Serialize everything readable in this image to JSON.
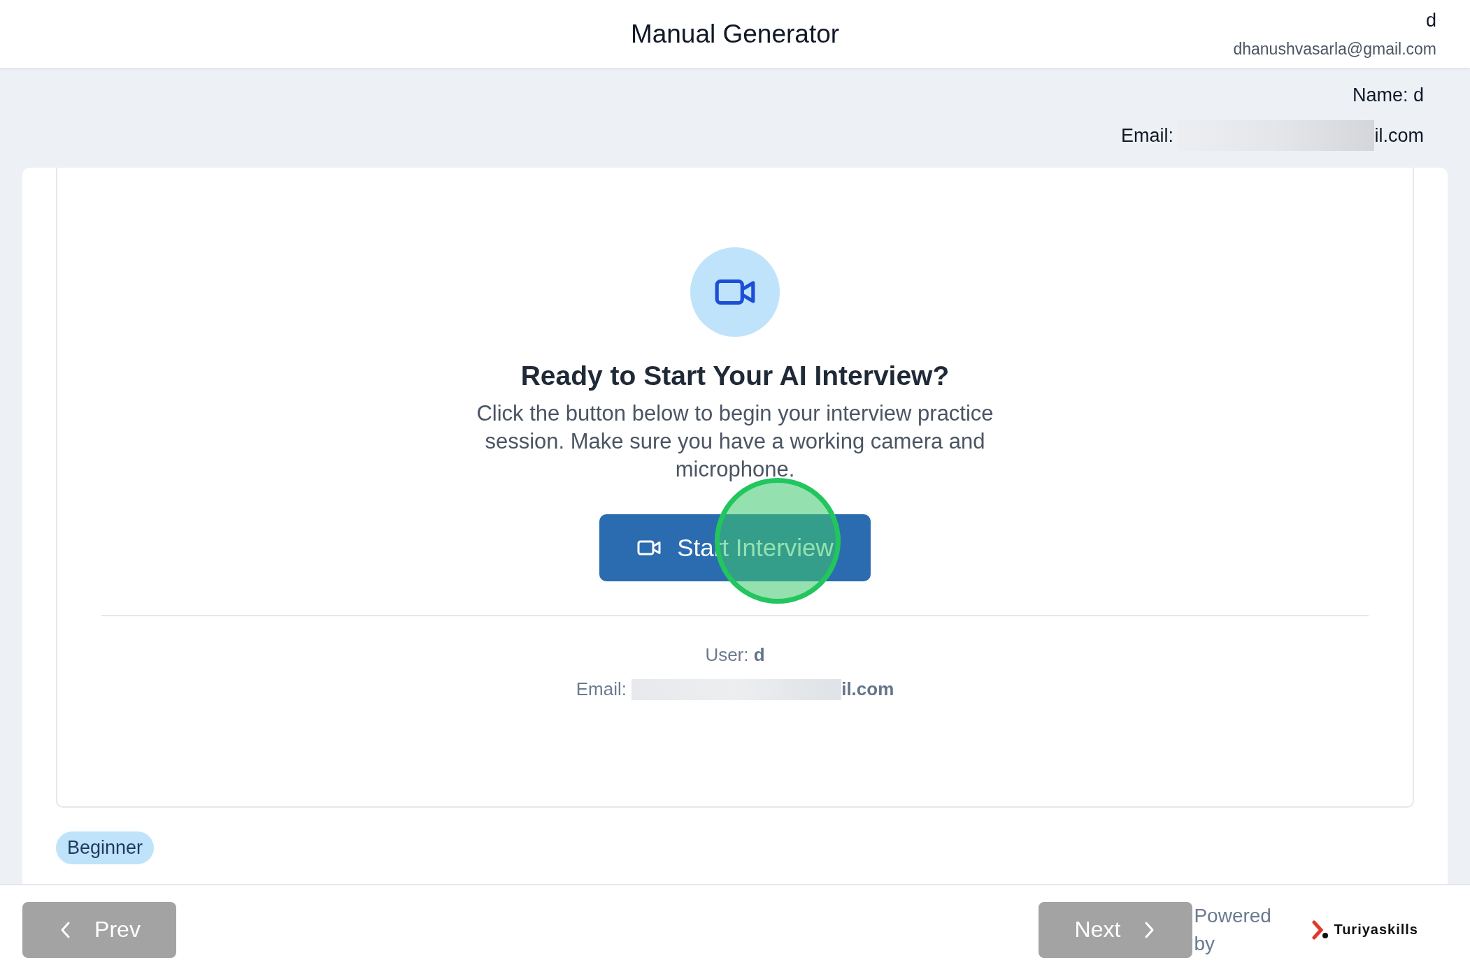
{
  "header": {
    "title": "Manual Generator",
    "user_name": "d",
    "user_email": "dhanushvasarla@gmail.com"
  },
  "profile": {
    "name_line": "Name: d",
    "email_label": "Email:",
    "email_redacted": true,
    "email_tail": "il.com"
  },
  "start_panel": {
    "heading": "Ready to Start Your AI Interview?",
    "description": "Click the button below to begin your interview practice session. Make sure you have a working camera and microphone.",
    "button": "Start Interview",
    "click_marker": true
  },
  "user_info": {
    "user_label": "User:",
    "user_value": "d",
    "email_label": "Email:",
    "email_redacted": true,
    "email_tail": "il.com"
  },
  "level_badge": "Beginner",
  "footer": {
    "prev": "Prev",
    "next": "Next",
    "powered_by": "Powered by",
    "brand": "Turiyaskills",
    "prev_disabled": true,
    "next_disabled": true
  }
}
